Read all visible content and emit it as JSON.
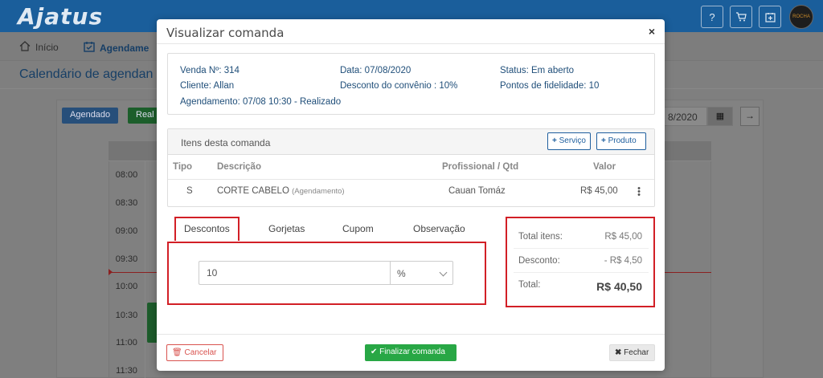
{
  "app": {
    "logo": "Ajatus",
    "header_icons": [
      "help-icon",
      "cart-icon",
      "calendar-add-icon"
    ],
    "avatar_text": "ROCHA"
  },
  "nav": {
    "home": "Início",
    "agenda": "Agendame"
  },
  "page": {
    "title": "Calendário de agendan",
    "chips": {
      "agendado": "Agendado",
      "realizado": "Real"
    },
    "date_partial": "8/2020",
    "times": [
      "08:00",
      "08:30",
      "09:00",
      "09:30",
      "10:00",
      "10:30",
      "11:00",
      "11:30"
    ]
  },
  "modal": {
    "title": "Visualizar comanda",
    "close_glyph": "×",
    "info": {
      "venda": "Venda Nº: 314",
      "data": "Data: 07/08/2020",
      "status": "Status: Em aberto",
      "cliente": "Cliente: Allan",
      "desconto_convenio": "Desconto do convênio : 10%",
      "pontos": "Pontos de fidelidade: 10",
      "agendamento": "Agendamento: 07/08 10:30 - Realizado"
    },
    "items": {
      "title": "Itens desta comanda",
      "add_service": "Serviço",
      "add_product": "Produto",
      "columns": {
        "tipo": "Tipo",
        "descricao": "Descrição",
        "profissional": "Profissional / Qtd",
        "valor": "Valor"
      },
      "rows": [
        {
          "tipo": "S",
          "descricao": "CORTE CABELO",
          "origem": "(Agendamento)",
          "profissional": "Cauan Tomáz",
          "valor": "R$ 45,00"
        }
      ]
    },
    "tabs": [
      "Descontos",
      "Gorjetas",
      "Cupom",
      "Observação"
    ],
    "active_tab": "Descontos",
    "discount": {
      "value": "10",
      "unit": "%"
    },
    "totals": {
      "itens_label": "Total itens:",
      "itens_value": "R$ 45,00",
      "desconto_label": "Desconto:",
      "desconto_value": "- R$ 4,50",
      "total_label": "Total:",
      "total_value": "R$ 40,50"
    },
    "footer": {
      "cancel": "Cancelar",
      "finish": "Finalizar comanda",
      "close": "Fechar"
    }
  },
  "colors": {
    "primary": "#1f5f9e",
    "highlight": "#d21f26",
    "success": "#28a745",
    "danger": "#d9534f"
  }
}
